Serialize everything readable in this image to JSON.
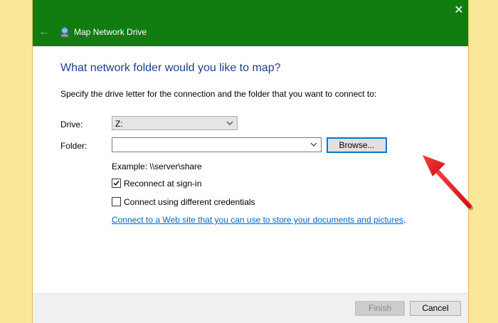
{
  "window": {
    "title": "Map Network Drive",
    "close_glyph": "✕",
    "back_glyph": "←"
  },
  "content": {
    "heading": "What network folder would you like to map?",
    "instruction": "Specify the drive letter for the connection and the folder that you want to connect to:",
    "drive_label": "Drive:",
    "drive_value": "Z:",
    "folder_label": "Folder:",
    "folder_value": "",
    "browse_label": "Browse...",
    "example": "Example: \\\\server\\share",
    "reconnect": {
      "label": "Reconnect at sign-in",
      "checked": true
    },
    "credentials": {
      "label": "Connect using different credentials",
      "checked": false
    },
    "link_text": "Connect to a Web site that you can use to store your documents and pictures",
    "link_suffix": "."
  },
  "footer": {
    "finish_label": "Finish",
    "cancel_label": "Cancel"
  },
  "colors": {
    "titlebar": "#117d11",
    "heading": "#1f3f8a",
    "link": "#0066cc",
    "arrow": "#e02020",
    "backdrop": "#f9e79a"
  },
  "icons": {
    "app": "network-drive-icon",
    "close": "close-icon",
    "back": "back-arrow-icon",
    "dropdown": "chevron-down-icon",
    "check": "checkmark-icon",
    "annotation": "red-arrow-icon"
  }
}
